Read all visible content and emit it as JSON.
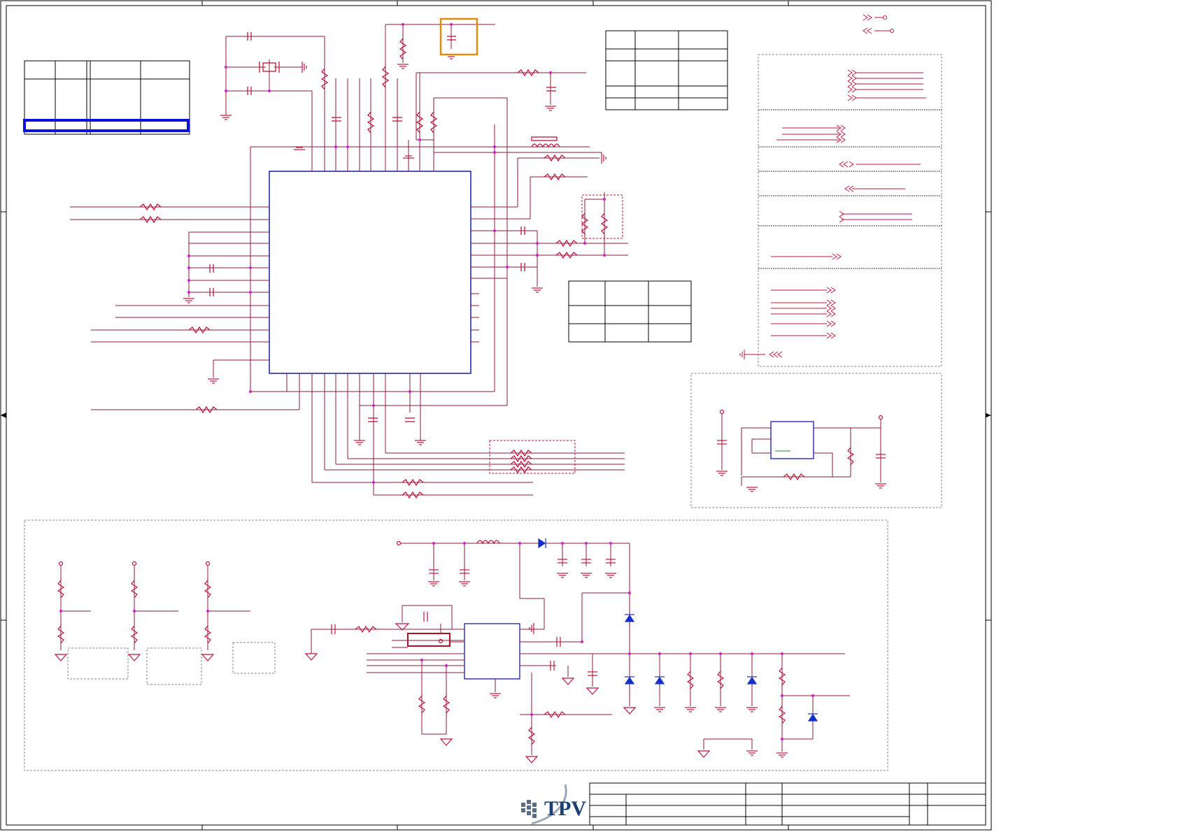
{
  "logo": {
    "text": "TPV"
  },
  "colors": {
    "wire": "#8b1a3a",
    "component": "#c0143c",
    "ic_outline": "#1a1aa8",
    "junction": "#d020d0",
    "frame": "#000000",
    "dashed_box": "#888888",
    "highlight_orange": "#e08a10",
    "highlight_blue": "#0b12d8",
    "highlight_red": "#b01020",
    "diode": "#1530c8"
  }
}
